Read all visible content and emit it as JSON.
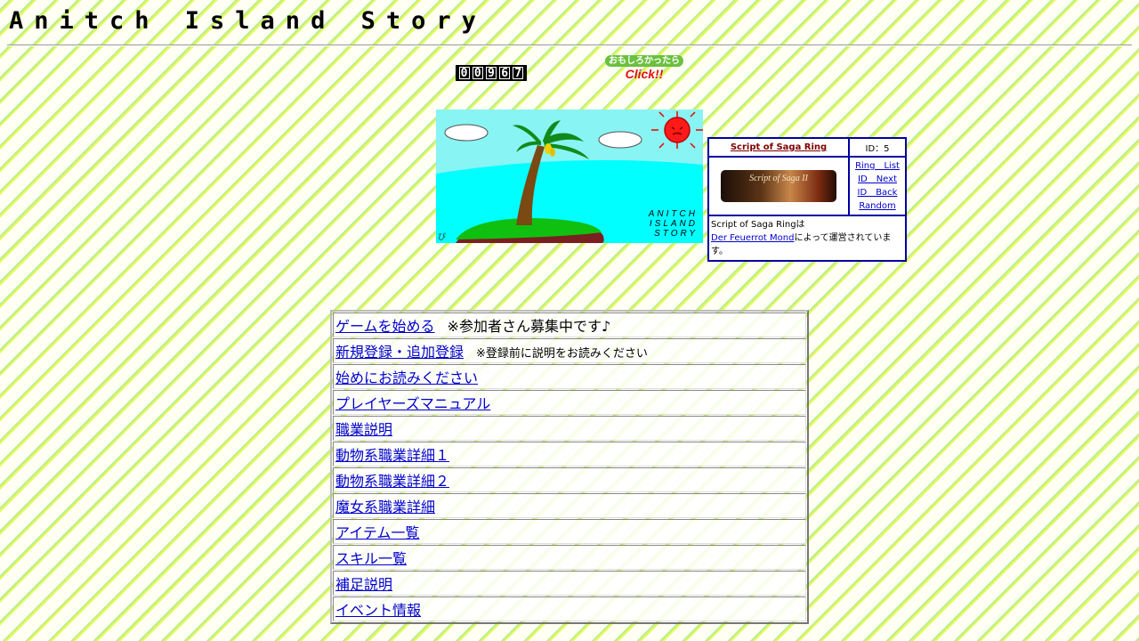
{
  "header": {
    "title": "Anitch Island Story"
  },
  "counter": {
    "digits": [
      "0",
      "0",
      "9",
      "6",
      "7"
    ]
  },
  "click_banner": {
    "top_text": "おもしろかったら",
    "bottom_text": "Click!!"
  },
  "banner": {
    "logo_lines": [
      "ANITCH",
      "ISLAND",
      "STORY"
    ],
    "signature": "ぴ"
  },
  "webring": {
    "title": "Script of Saga Ring",
    "id_label": "ID：5",
    "image_text": "Script of Saga II",
    "links": [
      "Ring　List",
      "ID　Next",
      "ID　Back",
      "Random"
    ],
    "description_prefix": "Script of Saga Ringは",
    "admin_link": "Der Feuerrot Mond",
    "description_suffix": "によって運営されています。"
  },
  "menu": {
    "items": [
      {
        "label": "ゲームを始める",
        "note": "※参加者さん募集中です♪"
      },
      {
        "label": "新規登録・追加登録",
        "note": "※登録前に説明をお読みください"
      },
      {
        "label": "始めにお読みください"
      },
      {
        "label": "プレイヤーズマニュアル"
      },
      {
        "label": "職業説明"
      },
      {
        "label": "動物系職業詳細１"
      },
      {
        "label": "動物系職業詳細２"
      },
      {
        "label": "魔女系職業詳細"
      },
      {
        "label": "アイテム一覧"
      },
      {
        "label": "スキル一覧"
      },
      {
        "label": "補足説明"
      },
      {
        "label": "イベント情報"
      }
    ]
  },
  "colors": {
    "link": "#0000cc",
    "ring_border": "#0000a0",
    "ring_title": "#800000",
    "stripe_green": "#b8f090",
    "stripe_yellow": "#eaf858"
  }
}
